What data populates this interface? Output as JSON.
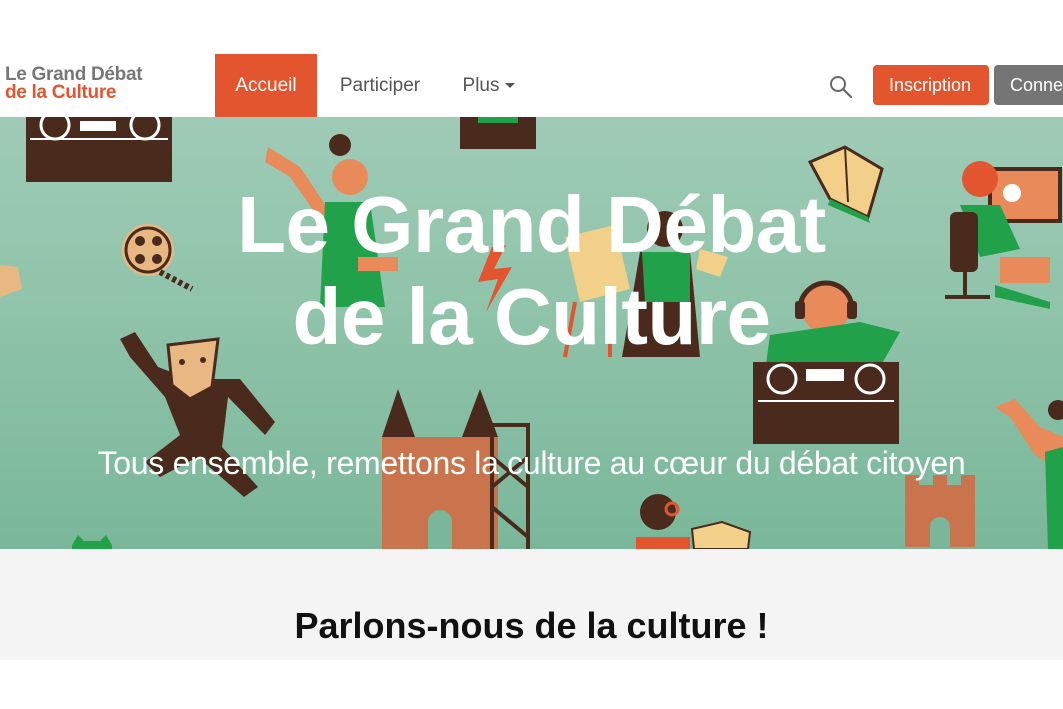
{
  "logo": {
    "line1": "Le Grand Débat",
    "line2": "de la Culture"
  },
  "nav": {
    "items": [
      {
        "label": "Accueil",
        "active": true
      },
      {
        "label": "Participer",
        "active": false
      },
      {
        "label": "Plus",
        "active": false
      }
    ],
    "search_icon": "search-icon",
    "signup_label": "Inscription",
    "login_label": "Connexion"
  },
  "hero": {
    "title_line1": "Le Grand Débat",
    "title_line2": "de la Culture",
    "subtitle": "Tous ensemble, remettons la culture au cœur du débat citoyen"
  },
  "section": {
    "title": "Parlons-nous de la culture !"
  },
  "colors": {
    "accent": "#e2552f",
    "hero_bg": "#8fc3aa",
    "login_bg": "#757575",
    "illustration_green": "#21a14a",
    "illustration_brown": "#4a2a1c",
    "illustration_orange": "#e88a5a"
  }
}
